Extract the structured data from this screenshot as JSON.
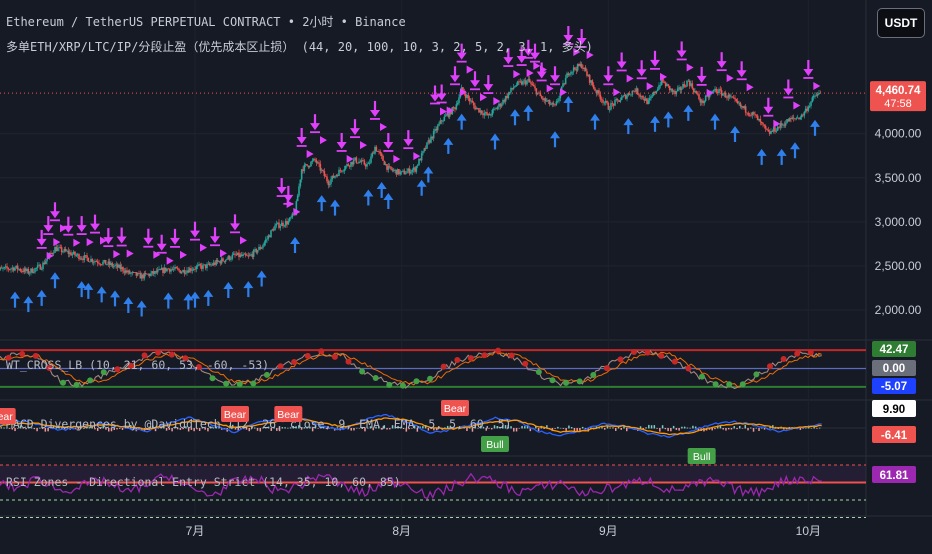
{
  "header": {
    "title_line1": "Ethereum / TetherUS PERPETUAL CONTRACT • 2小时 • Binance",
    "title_line2": "多单ETH/XRP/LTC/IP/分段止盈（优先成本区止损） (44, 20, 100, 10, 3, 2, 5, 2, 3, 1, 多头)",
    "currency_button": "USDT"
  },
  "colors": {
    "background": "#161a25",
    "bull_candle": "#26a69a",
    "bear_candle": "#ef5350",
    "buy_arrow": "#2f80ed",
    "sell_arrow": "#e040fb",
    "rsi_line": "#9c27b0",
    "macd_line": "#2962ff",
    "signal_line": "#ff9800"
  },
  "chart_data": [
    {
      "type": "candlestick",
      "panel": "price",
      "x_labels": [
        "7月",
        "8月",
        "9月",
        "10月"
      ],
      "x_label_positions_day": [
        30,
        61,
        92,
        122
      ],
      "x_range_days": [
        0,
        132
      ],
      "ylim": [
        1750,
        4950
      ],
      "y_ticks": [
        2000,
        2500,
        3000,
        3500,
        4000
      ],
      "y_tick_labels": [
        "2,000.00",
        "2,500.00",
        "3,000.00",
        "3,500.00",
        "4,000.00"
      ],
      "last_price": "4,460.74",
      "countdown": "47:58",
      "close_path_day": [
        0,
        3,
        5,
        7,
        9,
        11,
        13,
        15,
        17,
        19,
        20,
        22,
        24,
        26,
        28,
        30,
        32,
        34,
        36,
        38,
        40,
        42,
        44,
        45,
        46,
        48,
        50,
        52,
        54,
        56,
        57,
        59,
        61,
        63,
        65,
        67,
        69,
        70,
        72,
        74,
        76,
        78,
        80,
        82,
        84,
        86,
        88,
        90,
        92,
        94,
        96,
        98,
        100,
        102,
        104,
        106,
        108,
        110,
        112,
        114,
        116,
        117,
        119,
        121,
        123,
        124
      ],
      "close_path_price": [
        2450,
        2480,
        2430,
        2500,
        2700,
        2650,
        2600,
        2560,
        2520,
        2470,
        2420,
        2380,
        2420,
        2470,
        2440,
        2480,
        2500,
        2560,
        2620,
        2600,
        2720,
        2950,
        3000,
        3100,
        3600,
        3700,
        3450,
        3600,
        3700,
        3640,
        3850,
        3600,
        3550,
        3600,
        3900,
        4150,
        4300,
        4500,
        4300,
        4200,
        4350,
        4550,
        4600,
        4400,
        4300,
        4700,
        4780,
        4500,
        4300,
        4400,
        4500,
        4350,
        4600,
        4450,
        4600,
        4350,
        4500,
        4420,
        4300,
        4200,
        4000,
        4050,
        4150,
        4200,
        4430,
        4460
      ],
      "buy_signals_day": [
        3,
        5,
        7,
        9,
        13,
        14,
        16,
        18,
        20,
        22,
        26,
        29,
        30,
        32,
        35,
        38,
        40,
        45,
        49,
        51,
        56,
        58,
        59,
        64,
        65,
        68,
        70,
        75,
        78,
        80,
        84,
        86,
        90,
        95,
        99,
        101,
        104,
        108,
        111,
        115,
        118,
        120,
        123
      ],
      "sell_signals_day": [
        7,
        8,
        9,
        11,
        13,
        15,
        17,
        19,
        23,
        25,
        27,
        30,
        33,
        36,
        43,
        44,
        46,
        48,
        52,
        54,
        57,
        59,
        62,
        66,
        67,
        69,
        70,
        72,
        74,
        77,
        79,
        80,
        81,
        82,
        84,
        86,
        88,
        92,
        94,
        97,
        99,
        103,
        106,
        109,
        112,
        116,
        119,
        122
      ],
      "current_price_line": 4460.74
    },
    {
      "type": "line",
      "panel": "wt_cross",
      "title": "WT_CROSS_LB (10, 21, 60, 53, -60, -53)",
      "ylim": [
        -90,
        80
      ],
      "levels": [
        60,
        0,
        -60
      ],
      "value_labels": [
        "42.47",
        "0.00",
        "-5.07"
      ],
      "series_values": [
        30,
        45,
        35,
        -40,
        -55,
        -20,
        10,
        40,
        55,
        20,
        -30,
        -55,
        -40,
        0,
        35,
        52,
        40,
        -10,
        -45,
        -58,
        -30,
        15,
        45,
        55,
        30,
        -20,
        -50,
        -45,
        5,
        40,
        58,
        35,
        -15,
        -50,
        -60,
        -25,
        20,
        50,
        42
      ]
    },
    {
      "type": "line",
      "panel": "macd",
      "title": "MACD Divergences by @DaviddTech (12, 26, close, 9, EMA, EMA, 5, 5, 60, 5)",
      "ylim": [
        -60,
        60
      ],
      "value_labels": [
        "9.90",
        "-6.41"
      ],
      "annotations": [
        "Bear",
        "Bear",
        "Bear",
        "Bear",
        "Bull",
        "Bull"
      ],
      "annotations_day": [
        1,
        36,
        44,
        69,
        75,
        106
      ],
      "macd_values": [
        5,
        18,
        10,
        -6,
        4,
        12,
        0,
        -8,
        14,
        26,
        8,
        -10,
        12,
        22,
        28,
        6,
        -5,
        20,
        34,
        14,
        -12,
        -4,
        10,
        25,
        18,
        -8,
        -20,
        -6,
        12,
        4,
        -14,
        -22,
        -8,
        10,
        16,
        6,
        -8,
        2,
        10
      ],
      "signal_values": [
        3,
        12,
        11,
        2,
        3,
        8,
        4,
        -3,
        7,
        18,
        13,
        1,
        7,
        16,
        23,
        13,
        3,
        13,
        26,
        20,
        2,
        -2,
        5,
        17,
        18,
        4,
        -10,
        -8,
        4,
        5,
        -6,
        -16,
        -12,
        2,
        11,
        9,
        0,
        1,
        6
      ]
    },
    {
      "type": "line",
      "panel": "rsi",
      "title": "RSI Zones - Directional Entry Strict (14, 35, 10, 60, 85)",
      "ylim": [
        15,
        95
      ],
      "levels": [
        85,
        60,
        35,
        10
      ],
      "value_labels": [
        "61.81"
      ],
      "series_values": [
        60,
        52,
        66,
        48,
        55,
        63,
        45,
        58,
        70,
        50,
        42,
        60,
        66,
        47,
        56,
        72,
        55,
        44,
        62,
        58,
        40,
        54,
        68,
        61,
        47,
        52,
        60,
        44,
        50,
        57,
        64,
        48,
        55,
        62,
        50,
        45,
        60,
        66,
        62
      ]
    }
  ]
}
